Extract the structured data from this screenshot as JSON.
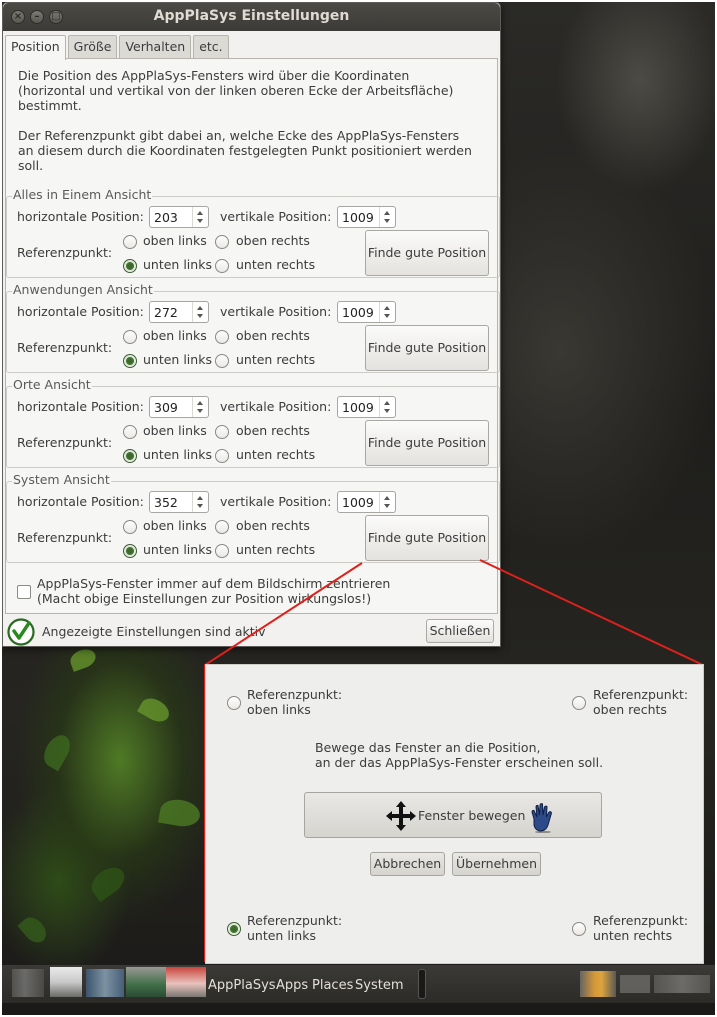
{
  "window": {
    "title": "AppPlaSys Einstellungen",
    "tabs": [
      {
        "label": "Position",
        "active": true
      },
      {
        "label": "Größe",
        "active": false
      },
      {
        "label": "Verhalten",
        "active": false
      },
      {
        "label": "etc.",
        "active": false
      }
    ],
    "intro_lines": [
      "Die Position des AppPlaSys-Fensters wird über die Koordinaten",
      "(horizontal und vertikal von der linken oberen Ecke der Arbeitsfläche)",
      "bestimmt.",
      "Der Referenzpunkt gibt dabei an, welche Ecke des AppPlaSys-Fensters",
      "an diesem durch die Koordinaten festgelegten Punkt positioniert werden soll."
    ],
    "labels": {
      "horizontal": "horizontale Position:",
      "vertical": "vertikale Position:",
      "reference": "Referenzpunkt:",
      "top_left": "oben links",
      "top_right": "oben rechts",
      "bottom_left": "unten links",
      "bottom_right": "unten rechts",
      "find_button": "Finde gute Position"
    },
    "groups": [
      {
        "title": "Alles in Einem Ansicht",
        "horizontal": "203",
        "vertical": "1009",
        "selected": "unten links"
      },
      {
        "title": "Anwendungen Ansicht",
        "horizontal": "272",
        "vertical": "1009",
        "selected": "unten links"
      },
      {
        "title": "Orte Ansicht",
        "horizontal": "309",
        "vertical": "1009",
        "selected": "unten links"
      },
      {
        "title": "System Ansicht",
        "horizontal": "352",
        "vertical": "1009",
        "selected": "unten links"
      }
    ],
    "center_checkbox": {
      "label": "AppPlaSys-Fenster immer auf dem Bildschirm zentrieren",
      "note": "(Macht obige Einstellungen zur Position wirkungslos!)",
      "checked": false
    },
    "status_text": "Angezeigte Einstellungen sind aktiv",
    "close_button": "Schließen"
  },
  "positioner": {
    "ref_label": "Referenzpunkt:",
    "corners": {
      "top_left": "oben links",
      "top_right": "oben rechts",
      "bottom_left": "unten links",
      "bottom_right": "unten rechts"
    },
    "selected_corner": "bottom_left",
    "instruction_line1": "Bewege das Fenster an die Position,",
    "instruction_line2": "an der das AppPlaSys-Fenster erscheinen soll.",
    "move_button": "Fenster bewegen",
    "cancel_button": "Abbrechen",
    "apply_button": "Übernehmen",
    "icons": {
      "move": "move-arrows-icon",
      "hand": "hand-cursor-icon"
    }
  },
  "taskbar": {
    "menus": [
      "AppPlaSys",
      "Apps",
      "Places",
      "System"
    ]
  },
  "colors": {
    "callout_line": "#e0201a",
    "radio_selected": "#4a7a39",
    "titlebar": "#3c3b37"
  }
}
